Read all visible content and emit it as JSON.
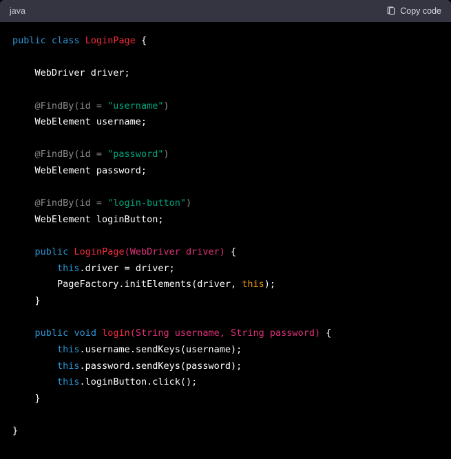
{
  "header": {
    "language": "java",
    "copy_label": "Copy code"
  },
  "code": {
    "l1_kw1": "public",
    "l1_kw2": "class",
    "l1_cls": "LoginPage",
    "l1_brace": " {",
    "l3": "    WebDriver driver;",
    "l5_ann": "    @FindBy(id = ",
    "l5_str": "\"username\"",
    "l5_end": ")",
    "l6": "    WebElement username;",
    "l8_ann": "    @FindBy(id = ",
    "l8_str": "\"password\"",
    "l8_end": ")",
    "l9": "    WebElement password;",
    "l11_ann": "    @FindBy(id = ",
    "l11_str": "\"login-button\"",
    "l11_end": ")",
    "l12": "    WebElement loginButton;",
    "l14_kw": "public",
    "l14_fn": "LoginPage",
    "l14_sig": "(WebDriver driver)",
    "l14_brace": " {",
    "l15_this": "this",
    "l15_rest": ".driver = driver;",
    "l16_a": "        PageFactory.initElements(driver, ",
    "l16_this": "this",
    "l16_b": ");",
    "l17": "    }",
    "l19_kw1": "public",
    "l19_kw2": "void",
    "l19_fn": "login",
    "l19_sig": "(String username, String password)",
    "l19_brace": " {",
    "l20_this": "this",
    "l20_rest": ".username.sendKeys(username);",
    "l21_this": "this",
    "l21_rest": ".password.sendKeys(password);",
    "l22_this": "this",
    "l22_rest": ".loginButton.click();",
    "l23": "    }",
    "l25": "}",
    "indent4": "    ",
    "indent8": "        ",
    "space": " "
  }
}
